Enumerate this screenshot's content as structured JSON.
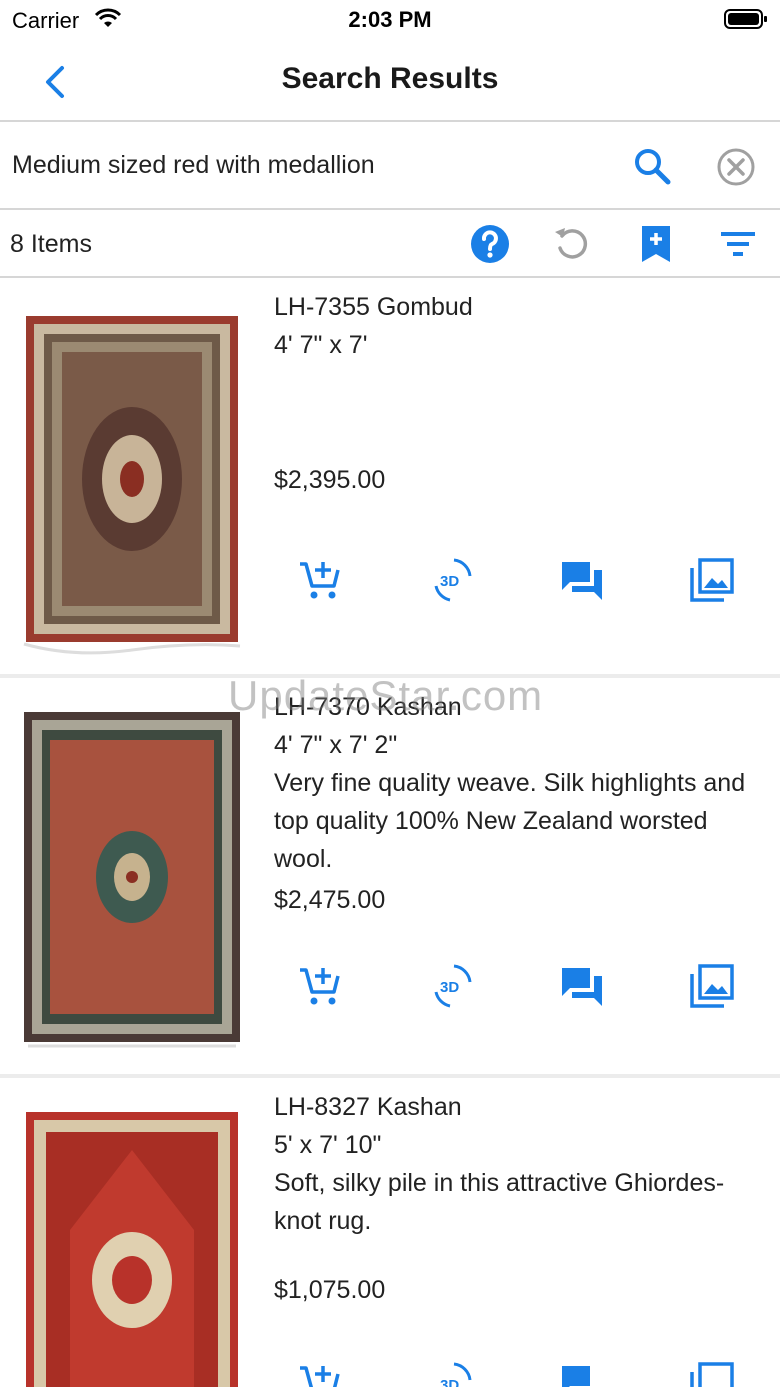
{
  "status_bar": {
    "carrier": "Carrier",
    "time": "2:03 PM"
  },
  "nav": {
    "title": "Search Results"
  },
  "search": {
    "query": "Medium sized red with medallion"
  },
  "toolbar": {
    "items_count": "8 Items"
  },
  "items": [
    {
      "name": "LH-7355 Gombud",
      "size": "4' 7\" x 7'",
      "description": "",
      "price": "$2,395.00"
    },
    {
      "name": "LH-7370 Kashan",
      "size": "4' 7\" x 7' 2\"",
      "description": "Very fine quality weave. Silk highlights and top quality 100% New Zealand worsted wool.",
      "price": "$2,475.00"
    },
    {
      "name": "LH-8327 Kashan",
      "size": "5' x 7' 10\"",
      "description": "Soft, silky pile in this attractive Ghiordes-knot rug.",
      "price": "$1,075.00"
    }
  ],
  "watermark": "UpdateStar.com",
  "colors": {
    "accent": "#1a7fe6",
    "icon_gray": "#a0a0a0",
    "separator": "#d6d6d6"
  },
  "icons": [
    "back-chevron",
    "search",
    "clear",
    "help",
    "refresh",
    "bookmark-add",
    "filter",
    "add-to-cart",
    "view-3d",
    "chat",
    "gallery"
  ]
}
